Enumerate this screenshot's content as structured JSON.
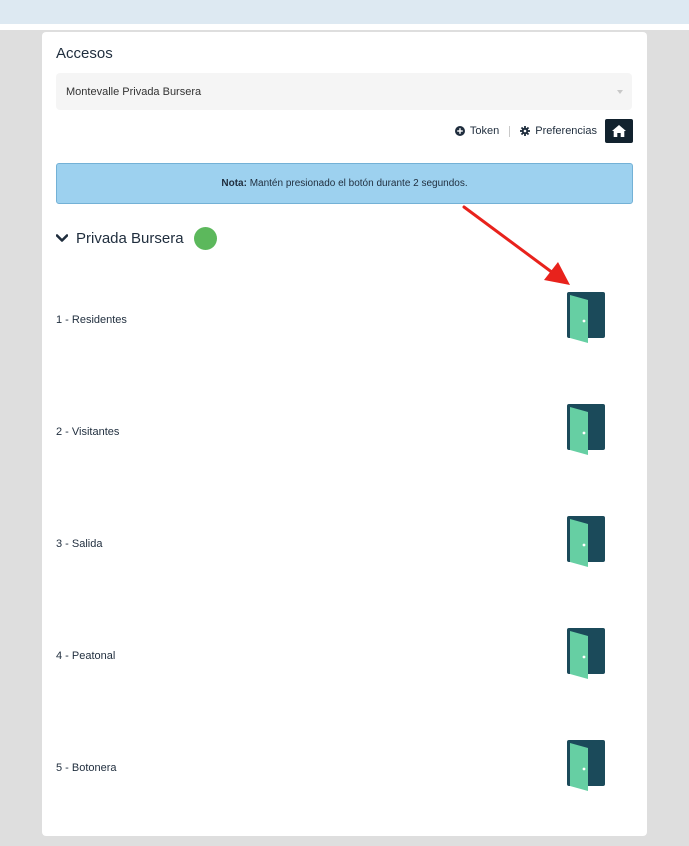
{
  "header": {
    "title": "Accesos"
  },
  "site_select": {
    "value": "Montevalle Privada Bursera"
  },
  "toolbar": {
    "token_label": "Token",
    "preferences_label": "Preferencias"
  },
  "note": {
    "label": "Nota:",
    "text": " Mantén presionado el botón durante 2 segundos."
  },
  "group": {
    "title": "Privada Bursera",
    "status_color": "#5cb85c"
  },
  "accesses": [
    {
      "label": "1 - Residentes"
    },
    {
      "label": "2 - Visitantes"
    },
    {
      "label": "3 - Salida"
    },
    {
      "label": "4 - Peatonal"
    },
    {
      "label": "5 - Botonera"
    }
  ],
  "colors": {
    "door_frame": "#1b4a5a",
    "door_panel": "#66cfa3",
    "annotation_arrow": "#e8221c"
  }
}
